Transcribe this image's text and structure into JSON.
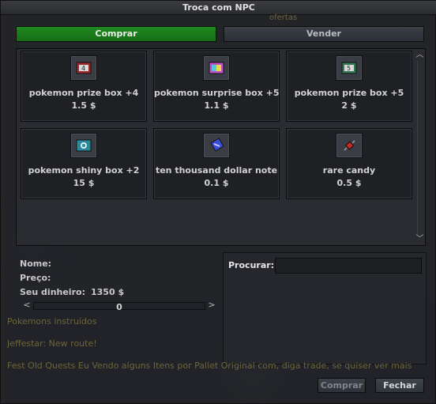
{
  "window": {
    "title": "Troca com NPC"
  },
  "background": {
    "top_tag": "ofertas",
    "chat_lines": [
      "Pokemons instruídos",
      "Jeffestar: New route!",
      "Fest Old Quests Eu Vendo alguns Itens por Pallet Original com, diga trade, se quiser ver mais"
    ]
  },
  "tabs": {
    "buy": "Comprar",
    "sell": "Vender"
  },
  "items": [
    {
      "name": "pokemon prize box +4",
      "price": "1.5 $",
      "icon": "prize-box-icon"
    },
    {
      "name": "pokemon surprise box +5",
      "price": "1.1 $",
      "icon": "surprise-box-icon"
    },
    {
      "name": "pokemon prize box +5",
      "price": "2 $",
      "icon": "prize-box-icon"
    },
    {
      "name": "pokemon shiny box +2",
      "price": "15 $",
      "icon": "shiny-box-icon"
    },
    {
      "name": "ten thousand dollar note",
      "price": "0.1 $",
      "icon": "dollar-note-icon"
    },
    {
      "name": "rare candy",
      "price": "0.5 $",
      "icon": "rare-candy-icon"
    }
  ],
  "info": {
    "name_label": "Nome:",
    "price_label": "Preço:",
    "money_label": "Seu dinheiro:",
    "money_value": "1350 $",
    "quantity": "0"
  },
  "search": {
    "label": "Procurar:",
    "value": "",
    "placeholder": ""
  },
  "buttons": {
    "buy": "Comprar",
    "close": "Fechar"
  },
  "colors": {
    "buy_tab": "#1f8a1f",
    "panel_bg": "#2a2c31"
  }
}
